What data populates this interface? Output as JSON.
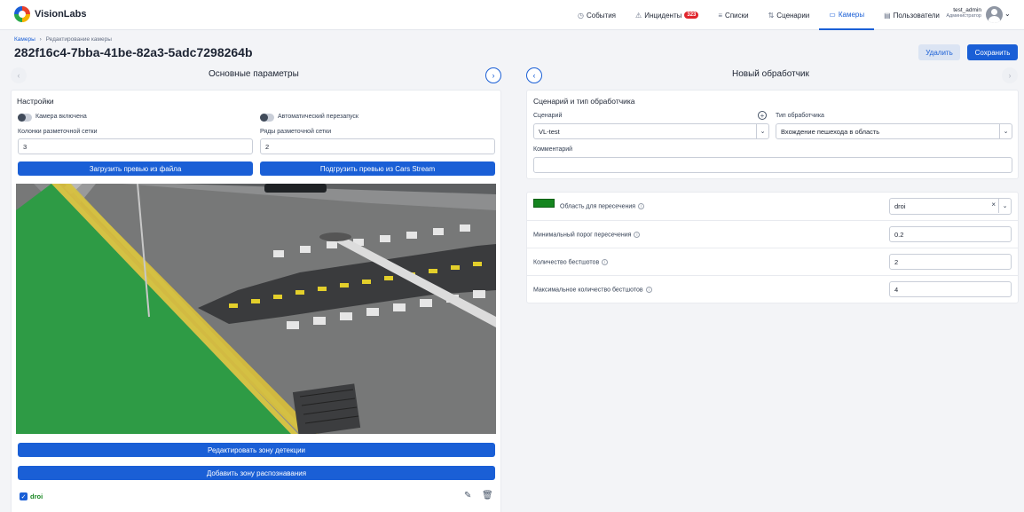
{
  "app": {
    "brand": "VisionLabs"
  },
  "nav": {
    "items": [
      {
        "label": "События",
        "icon": "clock-icon",
        "glyph": "◷"
      },
      {
        "label": "Инциденты",
        "icon": "warning-icon",
        "glyph": "⚠",
        "badge": "323"
      },
      {
        "label": "Списки",
        "icon": "list-icon",
        "glyph": "≡"
      },
      {
        "label": "Сценарии",
        "icon": "scenario-icon",
        "glyph": "⇅"
      },
      {
        "label": "Камеры",
        "icon": "camera-icon",
        "glyph": "▭",
        "active": true
      },
      {
        "label": "Пользователи",
        "icon": "users-icon",
        "glyph": "▤"
      }
    ]
  },
  "user": {
    "name": "test_admin",
    "role": "Администратор"
  },
  "breadcrumb": {
    "root": "Камеры",
    "separator": "›",
    "current": "Редактирование камеры"
  },
  "page": {
    "title": "282f16c4-7bba-41be-82a3-5adc7298264b"
  },
  "actions": {
    "delete": "Удалить",
    "save": "Сохранить"
  },
  "left": {
    "section_title": "Основные параметры",
    "prev": "‹",
    "next": "›",
    "settings": {
      "title": "Настройки",
      "camera_enabled": "Камера включена",
      "auto_restart": "Автоматический перезапуск",
      "grid_cols_label": "Колонки разметочной сетки",
      "grid_cols_value": "3",
      "grid_rows_label": "Ряды разметочной сетки",
      "grid_rows_value": "2",
      "upload_file": "Загрузить превью из файла",
      "upload_stream": "Подгрузить превью из Cars Stream",
      "edit_zone": "Редактировать зону детекции",
      "add_zone": "Добавить зону распознавания",
      "roi_name": "droi",
      "check": "✓"
    }
  },
  "right": {
    "section_title": "Новый обработчик",
    "prev": "‹",
    "next": "›",
    "handler": {
      "title": "Сценарий и тип обработчика",
      "scenario_label": "Сценарий",
      "scenario_value": "VL-test",
      "add": "+",
      "type_label": "Тип обработчика",
      "type_value": "Вхождение пешехода в область",
      "comment_label": "Комментарий",
      "comment_value": ""
    },
    "params": {
      "area_label": "Область для пересечения",
      "area_value": "droi",
      "area_color": "#15851f",
      "min_threshold_label": "Минимальный порог пересечения",
      "min_threshold_value": "0.2",
      "bestshots_label": "Количество бестшотов",
      "bestshots_value": "2",
      "max_bestshots_label": "Максимальное количество бестшотов",
      "max_bestshots_value": "4",
      "info": "i",
      "clear": "×",
      "arrow": "⌄"
    }
  },
  "colors": {
    "accent": "#1a5fd6",
    "zone": "#15851f",
    "badge": "#e0252c"
  }
}
